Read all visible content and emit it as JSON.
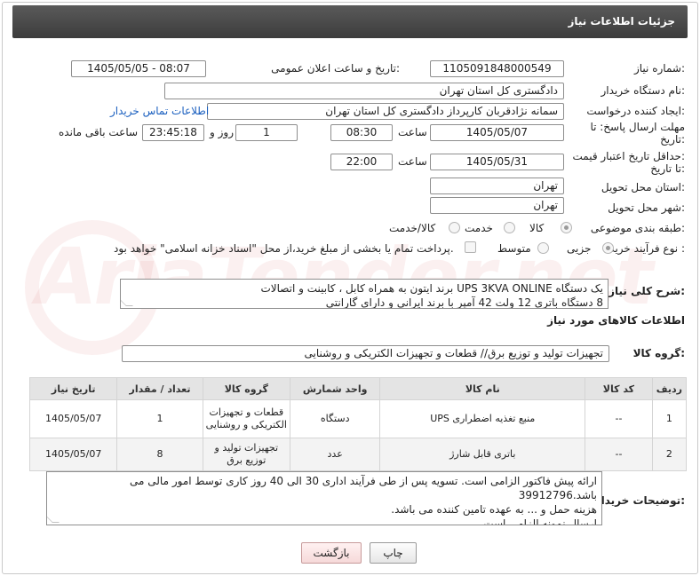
{
  "header": {
    "title": "جزئیات اطلاعات نیاز"
  },
  "watermark": {
    "text": "AriaTender.net"
  },
  "form": {
    "need_number": {
      "label": "شماره نیاز:",
      "value": "1105091848000549"
    },
    "announce_datetime": {
      "label": "تاریخ و ساعت اعلان عمومی:",
      "value": "1405/05/05 - 08:07"
    },
    "buyer_org": {
      "label": "نام دستگاه خریدار:",
      "value": "دادگستری کل استان تهران"
    },
    "creator": {
      "label": "ایجاد کننده درخواست:",
      "value": "سمانه نژادقربان کارپرداز دادگستری کل استان تهران",
      "contact_link": "اطلاعات تماس خریدار"
    },
    "deadline": {
      "label_line1": "مهلت ارسال پاسخ: تا",
      "label_line2": "تاریخ:",
      "date": "1405/05/07",
      "time_label": "ساعت",
      "time": "08:30",
      "days": "1",
      "days_label": "روز و",
      "remaining": "23:45:18",
      "remaining_label": "ساعت باقی مانده"
    },
    "price_validity": {
      "label_line1": "حداقل تاریخ اعتبار قیمت:",
      "label_line2": "تا تاریخ:",
      "date": "1405/05/31",
      "time_label": "ساعت",
      "time": "22:00"
    },
    "province": {
      "label": "استان محل تحویل:",
      "value": "تهران"
    },
    "city": {
      "label": "شهر محل تحویل:",
      "value": "تهران"
    },
    "category": {
      "label": "طبقه بندی موضوعی:",
      "options": [
        "کالا",
        "خدمت",
        "کالا/خدمت"
      ],
      "selected": "کالا"
    },
    "purchase_type": {
      "label": "نوع فرآیند خرید :",
      "options": [
        "جزیی",
        "متوسط"
      ],
      "selected": "جزیی",
      "payment_note": "پرداخت تمام یا بخشی از مبلغ خرید،از محل \"اسناد خزانه اسلامی\" خواهد بود."
    }
  },
  "summary": {
    "label": "شرح کلی نیاز:",
    "line1": "یک دستگاه UPS 3KVA ONLINE برند ایتون به همراه کابل ، کابینت و اتصالات",
    "line2": "8 دستگاه باتری 12 ولت 42 آمپر با برند ایرانی و دارای گارانتی"
  },
  "items_section": {
    "title": "اطلاعات کالاهای مورد نیاز"
  },
  "goods_group": {
    "label": "گروه کالا:",
    "value": "تجهیزات تولید و توزیع برق// قطعات و تجهیزات الکتریکی و روشنایی"
  },
  "table": {
    "headers": [
      "ردیف",
      "کد کالا",
      "نام کالا",
      "واحد شمارش",
      "گروه کالا",
      "تعداد / مقدار",
      "تاریخ نیاز"
    ],
    "rows": [
      {
        "idx": "1",
        "code": "--",
        "name": "منبع تغذیه اضطراری UPS",
        "unit": "دستگاه",
        "group": "قطعات و تجهیزات الکتریکی و روشنایی",
        "qty": "1",
        "date": "1405/05/07"
      },
      {
        "idx": "2",
        "code": "--",
        "name": "باتری قابل شارژ",
        "unit": "عدد",
        "group": "تجهیزات تولید و توزیع برق",
        "qty": "8",
        "date": "1405/05/07"
      }
    ]
  },
  "buyer_notes": {
    "label": "توضیحات خریدار:",
    "line1": "ارائه پیش فاکتور الزامی است. تسویه پس از طی فرآیند اداری 30 الی 40  روز کاری توسط امور مالی می باشد.39912796",
    "line2": "هزینه حمل و ... به عهده تامین کننده می باشد.",
    "line3": "ارسال نمونه الزامی است"
  },
  "buttons": {
    "print": "چاپ",
    "back": "بازگشت"
  }
}
